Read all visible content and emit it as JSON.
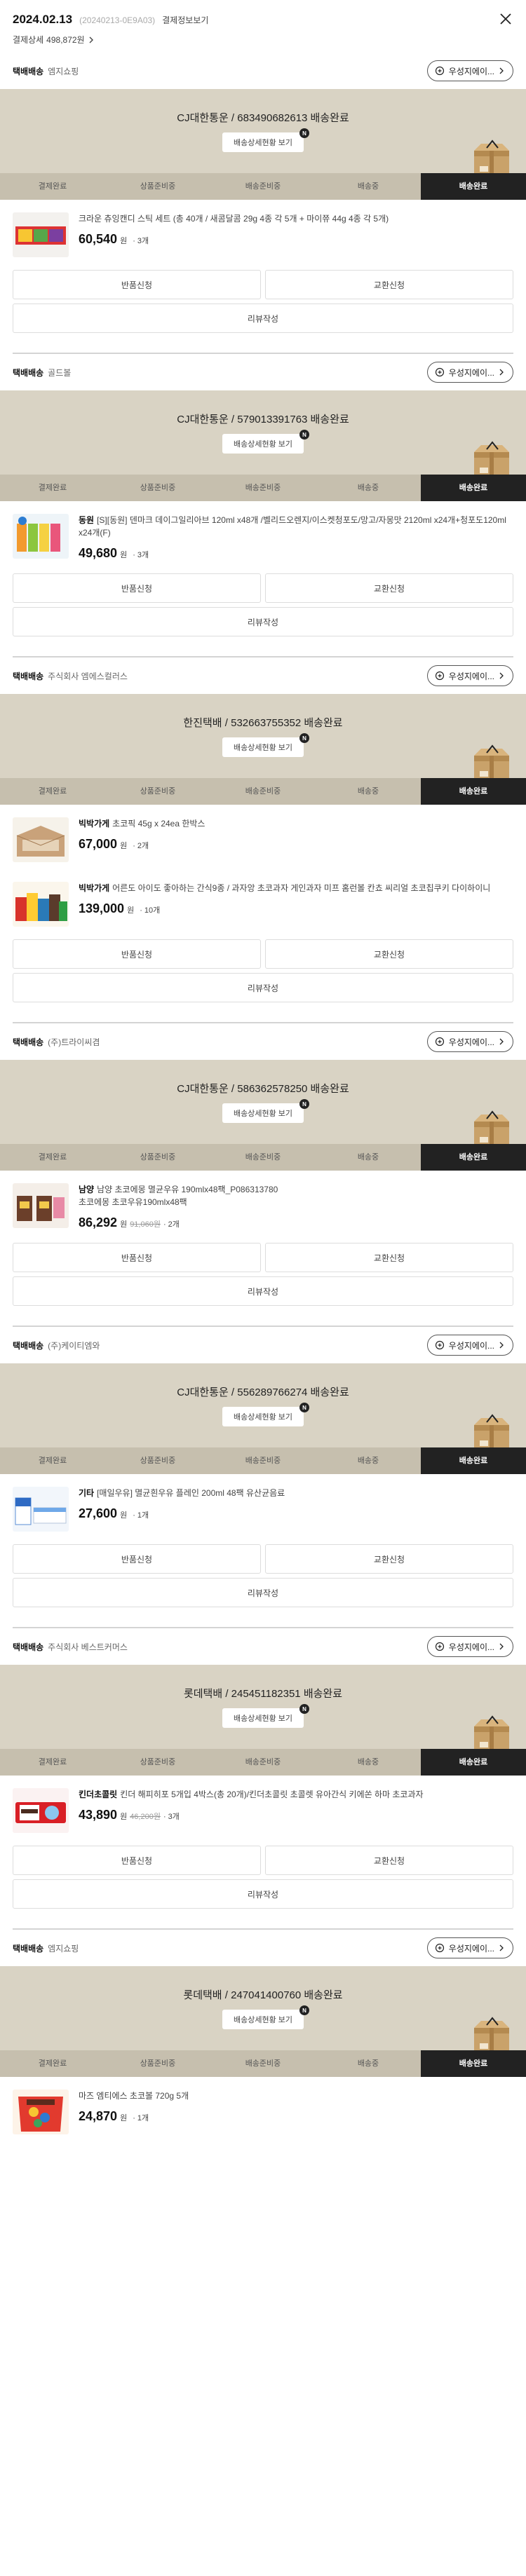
{
  "header": {
    "date": "2024.02.13",
    "order_no": "(20240213-0E9A03)",
    "detail_link": "결제정보보기",
    "amount_label": "결제상세",
    "amount_value": "498,872원"
  },
  "steps": [
    "결제완료",
    "상품준비중",
    "배송준비중",
    "배송중",
    "배송완료"
  ],
  "track_button": "배송상세현황 보기",
  "buttons": {
    "return": "반품신청",
    "exchange": "교환신청",
    "review": "리뷰작성"
  },
  "shipments": [
    {
      "type": "택배배송",
      "seller": "엠지쇼핑",
      "mart": "우성지에이...",
      "tracking": "CJ대한통운 / 683490682613 배송완료",
      "products": [
        {
          "brand": "",
          "name": "크라운 츄잉캔디 스틱 세트 (총 40개 / 새콤달콤 29g 4종 각 5개 + 마이쮸 44g 4종 각 5개)",
          "price": "60,540",
          "unit": "원",
          "orig": "",
          "qty": "· 3개",
          "img": "candy"
        }
      ],
      "actions": true
    },
    {
      "type": "택배배송",
      "seller": "골드볼",
      "mart": "우성지에이...",
      "tracking": "CJ대한통운 / 579013391763 배송완료",
      "products": [
        {
          "brand": "동원",
          "name": "[S][동원] 덴마크 데이그일리아브 120ml x48개 /벨리드오렌지/이스켓청포도/망고/자몽맛 2120ml x24개+청포도120ml x24개(F)",
          "price": "49,680",
          "unit": "원",
          "orig": "",
          "qty": "· 3개",
          "img": "juice"
        }
      ],
      "actions": true
    },
    {
      "type": "택배배송",
      "seller": "주식회사 엠에스컬러스",
      "mart": "우성지에이...",
      "tracking": "한진택배 / 532663755352 배송완료",
      "products": [
        {
          "brand": "빅박가게",
          "name": "초코픽 45g x 24ea 한박스",
          "price": "67,000",
          "unit": "원",
          "orig": "",
          "qty": "· 2개",
          "img": "box"
        },
        {
          "brand": "빅박가게",
          "name": "어른도 아이도 좋아하는 간식9종 / 과자앙 초코과자 게인과자 미프 홈런볼 칸쵸 씨리얼 초코칩쿠키 다이하이니",
          "price": "139,000",
          "unit": "원",
          "orig": "",
          "qty": "· 10개",
          "img": "snack"
        }
      ],
      "actions": true
    },
    {
      "type": "택배배송",
      "seller": "(주)트라이씨겸",
      "mart": "우성지에이...",
      "tracking": "CJ대한통운 / 586362578250 배송완료",
      "products": [
        {
          "brand": "남양",
          "name": "남양 초코에몽 멸균우유 190mlx48팩_P086313780\n초코에몽 초코우유190mlx48팩",
          "price": "86,292",
          "unit": "원",
          "orig": "91,060원",
          "qty": "· 2개",
          "img": "choco"
        }
      ],
      "actions": true
    },
    {
      "type": "택배배송",
      "seller": "(주)케이티엠와",
      "mart": "우성지에이...",
      "tracking": "CJ대한통운 / 556289766274 배송완료",
      "products": [
        {
          "brand": "기타",
          "name": "[매일우유] 멸균흰우유 플레인 200ml 48팩 유산균음료",
          "price": "27,600",
          "unit": "원",
          "orig": "",
          "qty": "· 1개",
          "img": "milk"
        }
      ],
      "actions": true
    },
    {
      "type": "택배배송",
      "seller": "주식회사 베스트커머스",
      "mart": "우성지에이...",
      "tracking": "롯데택배 / 245451182351 배송완료",
      "products": [
        {
          "brand": "킨더초콜릿",
          "name": "킨더 해피히포 5개입 4박스(총 20개)/킨더초콜릿 초콜렛 유아간식 키에쏜 하마 초코과자",
          "price": "43,890",
          "unit": "원",
          "orig": "46,200원",
          "qty": "· 3개",
          "img": "kinder"
        }
      ],
      "actions": true
    },
    {
      "type": "택배배송",
      "seller": "엠지쇼핑",
      "mart": "우성지에이...",
      "tracking": "롯데택배 / 247041400760 배송완료",
      "products": [
        {
          "brand": "",
          "name": "마즈 엠티에스 초코볼 720g 5개",
          "price": "24,870",
          "unit": "원",
          "orig": "",
          "qty": "· 1개",
          "img": "mms"
        }
      ],
      "actions": false
    }
  ]
}
